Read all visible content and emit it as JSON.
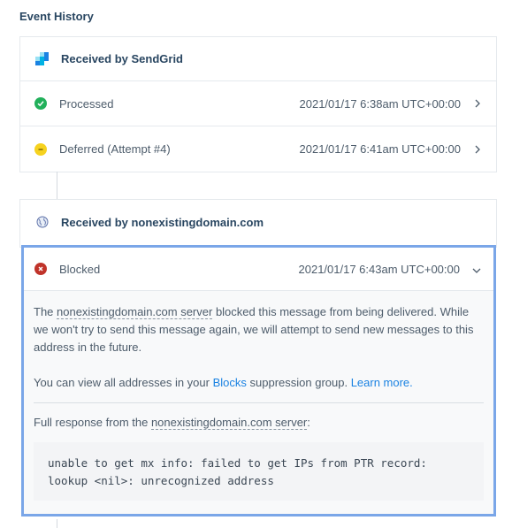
{
  "page_title": "Event History",
  "groups": [
    {
      "header": "Received by SendGrid",
      "header_icon": "sendgrid-logo-icon",
      "events": [
        {
          "status": "success",
          "label": "Processed",
          "time": "2021/01/17 6:38am UTC+00:00",
          "color": "#22b05b"
        },
        {
          "status": "warning",
          "label": "Deferred (Attempt #4)",
          "time": "2021/01/17 6:41am UTC+00:00",
          "color": "#f6d21f"
        }
      ]
    },
    {
      "header": "Received by nonexistingdomain.com",
      "header_icon": "globe-icon",
      "events": [
        {
          "status": "error",
          "label": "Blocked",
          "time": "2021/01/17 6:43am UTC+00:00",
          "color": "#c0332a"
        }
      ]
    }
  ],
  "blocked_detail": {
    "para1_prefix": "The ",
    "para1_domain_link": "nonexistingdomain.com server",
    "para1_suffix": " blocked this message from being delivered. While we won't try to send this message again, we will attempt to send new messages to this address in the future.",
    "para2_prefix": "You can view all addresses in your ",
    "para2_link": "Blocks",
    "para2_middle": " suppression group. ",
    "para2_learn_more": "Learn more.",
    "response_prefix": "Full response from the ",
    "response_domain": "nonexistingdomain.com server",
    "response_suffix": ":",
    "response_line1": "unable to get mx info: failed to get IPs from PTR record:",
    "response_line2": "lookup <nil>: unrecognized address"
  },
  "colors": {
    "highlight_border": "#7aa6e8",
    "link": "#1a82e2"
  }
}
